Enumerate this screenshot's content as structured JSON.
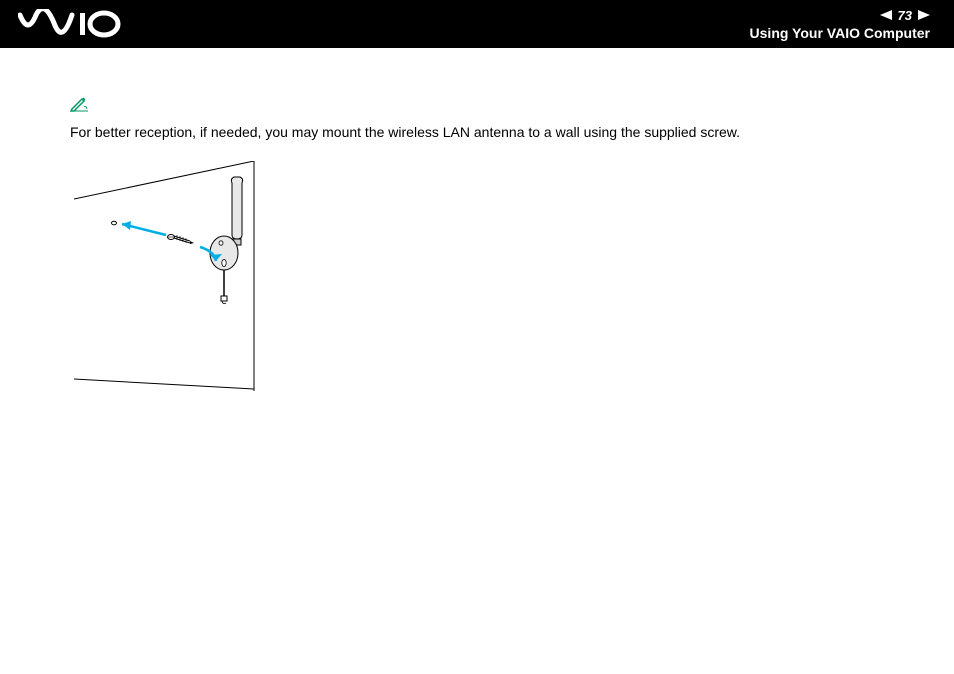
{
  "header": {
    "page_number": "73",
    "section_title": "Using Your VAIO Computer"
  },
  "content": {
    "note_text": "For better reception, if needed, you may mount the wireless LAN antenna to a wall using the supplied screw."
  },
  "colors": {
    "accent": "#00aee6",
    "stroke": "#000000"
  }
}
